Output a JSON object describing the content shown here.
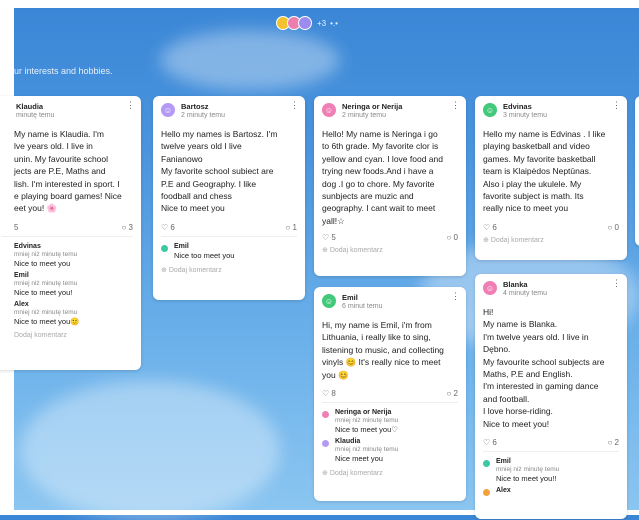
{
  "colors": {
    "sky": "#4b95de",
    "card": "#ffffff"
  },
  "header": {
    "subtitle": "ur interests and hobbies.",
    "members_extra": "+3",
    "members_dots": "•.•"
  },
  "cards": [
    {
      "name": "Klaudia",
      "time": "minutę temu",
      "body": "My name is Klaudia. I'm\nlve years old. I live in\nunin. My favourite school\njects are P.E, Maths and\nlish. I'm interested in sport. I\ne playing board games! Nice\neet you! 🌸",
      "likes": "5",
      "comments_count": "3",
      "comments": [
        {
          "name": "Edvinas",
          "time": "mniej niż minutę temu",
          "text": "Nice to meet you"
        },
        {
          "name": "Emil",
          "time": "mniej niż minutę temu",
          "text": "Nice to meet you!"
        },
        {
          "name": "Alex",
          "time": "mniej niż minutę temu",
          "text": "Nice to meet you🙂"
        }
      ],
      "add_comment": "Dodaj komentarz"
    },
    {
      "name": "Bartosz",
      "time": "2 minuty temu",
      "body": "Hello my names  is Bartosz. I'm\ntwelve years old I live\nFanianowo\nMy favorite school subiect  are\nP.E and Geography. I  like\nfoodball and chess\nNice to meet you",
      "likes": "6",
      "comments_count": "1",
      "comments": [
        {
          "name": "Emil",
          "time": "mniej niż minutę temu",
          "text": "Nice too meet you"
        }
      ],
      "add_comment": "Dodaj komentarz"
    },
    {
      "name": "Neringa or Nerija",
      "time": "2 minuty temu",
      "body": "Hello! My name is Neringa i go\nto 6th grade. My favorite clor is\nyellow and cyan. I love food and\ntrying new foods.And i have a\ndog .I go to chore. My favorite\nsunbjects are muzic and\ngeography. I cant wait to meet\nyall!☆",
      "likes": "5",
      "comments_count": "0",
      "comments": [],
      "add_comment": "Dodaj komentarz"
    },
    {
      "name": "Edvinas",
      "time": "3 minuty temu",
      "body": "Hello my name is Edvinas . I like\nplaying basketball and video\ngames. My favorite basketball\nteam is Klaipėdos Neptūnas.\nAlso i play the ukulele. My\nfavorite subject is math. Its\nreally nice to meet you",
      "likes": "6",
      "comments_count": "0",
      "comments": [],
      "add_comment": "Dodaj komentarz"
    },
    {
      "name": "Emil",
      "time": "6 minut temu",
      "body": "Hi, my name is Emil, i'm from\nLithuania, i really like to sing,\nlistening to music, and collecting\nvinyls 😊 It's really nice to meet\nyou 😊",
      "likes": "8",
      "comments_count": "2",
      "comments": [
        {
          "name": "Neringa or Nerija",
          "time": "mniej niż minutę temu",
          "text": "Nice to meet you♡"
        },
        {
          "name": "Klaudia",
          "time": "mniej niż minutę temu",
          "text": "Nice meet you"
        }
      ],
      "add_comment": "Dodaj komentarz"
    },
    {
      "name": "Blanka",
      "time": "4 minuty temu",
      "body": "Hi!\nMy name is Blanka.\nI'm twelve years old. I live in\nDębno.\nMy favourite school subjects are\nMaths, P.E and English.\nI'm interested in gaming dance\nand football.\nI love horse-riding.\nNice to meet you!",
      "likes": "6",
      "comments_count": "2",
      "comments": [
        {
          "name": "Emil",
          "time": "mniej niż minutę temu",
          "text": "Nice to meet you!!"
        },
        {
          "name": "Alex",
          "time": "mniej niż minutę temu",
          "text": ""
        }
      ],
      "add_comment": ""
    }
  ]
}
